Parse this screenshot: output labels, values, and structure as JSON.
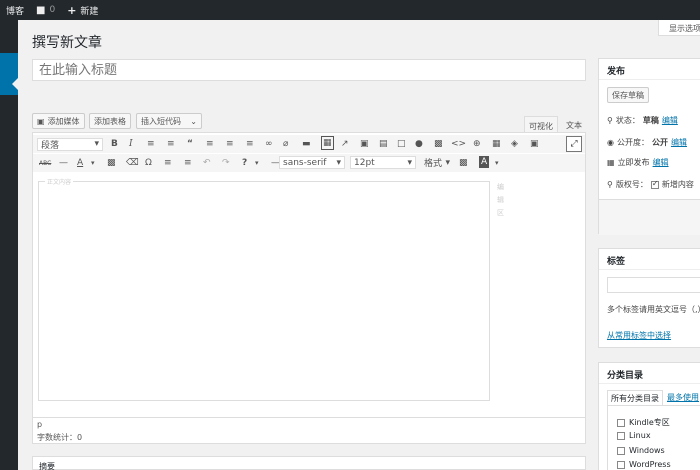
{
  "admin_bar": {
    "site_name": "博客",
    "comments_count": "0",
    "new_label": "新建"
  },
  "screen_options": "显示选项",
  "page_title": "撰写新文章",
  "title_input": {
    "placeholder": "在此输入标题"
  },
  "media_buttons": {
    "add_media": "添加媒体",
    "add_form": "添加表格",
    "insert_shortcode": "插入短代码"
  },
  "editor_tabs": {
    "visual": "可视化",
    "text": "文本"
  },
  "toolbar": {
    "paragraph_format": "段落",
    "font_family": "sans-serif",
    "font_size": "12pt",
    "formats": "格式"
  },
  "editor": {
    "legend": "正文内容",
    "side_tools": [
      "编",
      "辑",
      "区"
    ],
    "path": "p",
    "word_count": "字数统计：0"
  },
  "excerpt_title": "摘要",
  "publish_box": {
    "title": "发布",
    "save_draft": "保存草稿",
    "status_label": "状态：",
    "status_value": "草稿",
    "visibility_label": "公开度：",
    "visibility_value": "公开",
    "publish_now": "立即发布",
    "edit_link": "编辑",
    "copyright_label": "版权号：",
    "copyright_value": "新增内容"
  },
  "tags_box": {
    "title": "标签",
    "hint": "多个标签请用英文逗号（,）",
    "choose_link": "从常用标签中选择"
  },
  "categories_box": {
    "title": "分类目录",
    "tab_all": "所有分类目录",
    "tab_popular": "最多使用",
    "items": [
      "Kindle专区",
      "Linux",
      "Windows",
      "WordPress"
    ]
  }
}
